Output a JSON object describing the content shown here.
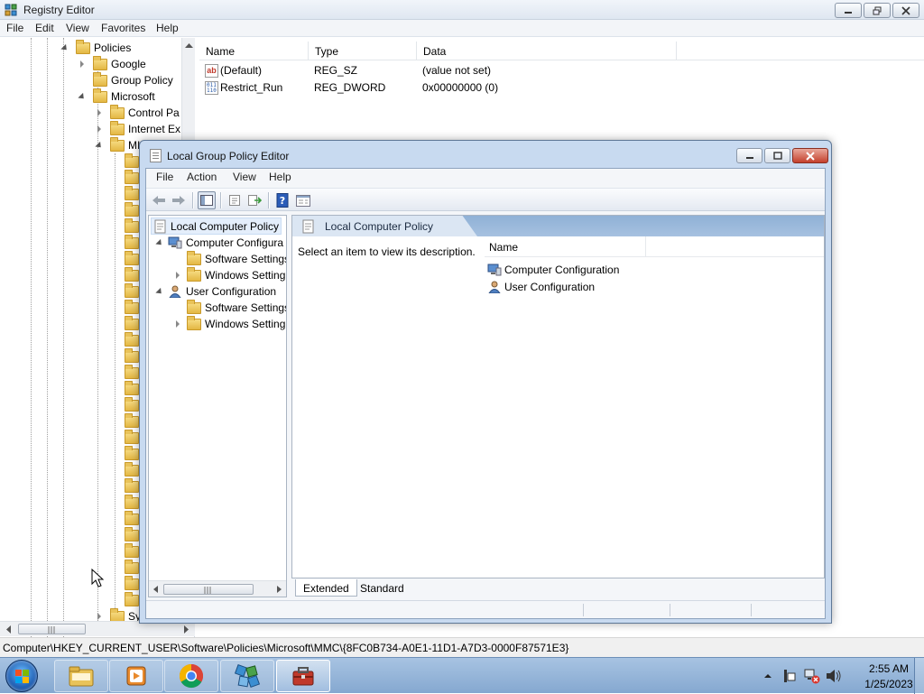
{
  "regedit": {
    "title": "Registry Editor",
    "menu": [
      "File",
      "Edit",
      "View",
      "Favorites",
      "Help"
    ],
    "tree": {
      "policies": "Policies",
      "google": "Google",
      "group_policy": "Group Policy",
      "microsoft": "Microsoft",
      "control_panel": "Control Pa",
      "internet_explorer": "Internet Ex",
      "mmc": "MI",
      "system": "Sy"
    },
    "columns": [
      "Name",
      "Type",
      "Data"
    ],
    "values": [
      {
        "name": "(Default)",
        "type": "REG_SZ",
        "data": "(value not set)",
        "icon": "string-value-icon"
      },
      {
        "name": "Restrict_Run",
        "type": "REG_DWORD",
        "data": "0x00000000 (0)",
        "icon": "binary-value-icon"
      }
    ],
    "status_path": "Computer\\HKEY_CURRENT_USER\\Software\\Policies\\Microsoft\\MMC\\{8FC0B734-A0E1-11D1-A7D3-0000F87571E3}"
  },
  "gpedit": {
    "title": "Local Group Policy Editor",
    "menu": [
      "File",
      "Action",
      "View",
      "Help"
    ],
    "toolbar": [
      "back-arrow-icon",
      "forward-arrow-icon",
      "show-hide-tree-icon",
      "properties-icon",
      "export-list-icon",
      "help-icon",
      "console-view-icon"
    ],
    "tree": {
      "root": "Local Computer Policy",
      "computer_config": "Computer Configura",
      "cc_software": "Software Settings",
      "cc_windows": "Windows Setting",
      "user_config": "User Configuration",
      "uc_software": "Software Settings",
      "uc_windows": "Windows Setting"
    },
    "right_title": "Local Computer Policy",
    "description": "Select an item to view its description.",
    "list_column": "Name",
    "items": [
      "Computer Configuration",
      "User Configuration"
    ],
    "tabs": {
      "extended": "Extended",
      "standard": "Standard"
    }
  },
  "taskbar": {
    "apps": [
      "windows-explorer-icon",
      "media-player-icon",
      "chrome-icon",
      "registry-editor-icon",
      "group-policy-editor-icon"
    ],
    "time": "2:55 AM",
    "date": "1/25/2023"
  },
  "colors": {
    "taskbar": "#95b4da",
    "gpe_frame": "#c8daf0",
    "folder": "#e9c35a",
    "close_button": "#c4402c"
  }
}
